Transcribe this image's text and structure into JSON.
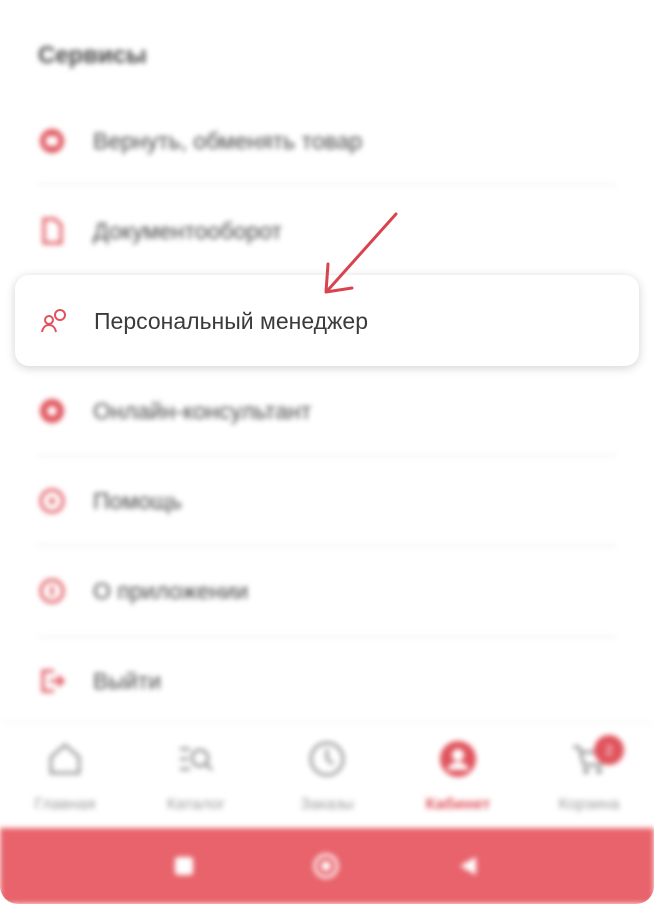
{
  "services": {
    "title": "Сервисы",
    "items": [
      {
        "label": "Вернуть, обменять товар",
        "icon": "return-box-icon"
      },
      {
        "label": "Документооборот",
        "icon": "document-icon"
      },
      {
        "label": "Персональный менеджер",
        "icon": "manager-icon"
      },
      {
        "label": "Онлайн-консультант",
        "icon": "chat-icon"
      },
      {
        "label": "Помощь",
        "icon": "help-icon"
      },
      {
        "label": "О приложении",
        "icon": "info-icon"
      },
      {
        "label": "Выйти",
        "icon": "logout-icon"
      }
    ]
  },
  "tabbar": {
    "tabs": [
      {
        "label": "Главная",
        "icon": "home-icon"
      },
      {
        "label": "Каталог",
        "icon": "catalog-search-icon"
      },
      {
        "label": "Заказы",
        "icon": "clock-icon"
      },
      {
        "label": "Кабинет",
        "icon": "profile-icon",
        "active": true
      },
      {
        "label": "Корзина",
        "icon": "cart-icon",
        "badge": "2"
      }
    ]
  },
  "colors": {
    "accent": "#e0535c",
    "navbar": "#e8636b",
    "text": "#4a4a4a"
  }
}
